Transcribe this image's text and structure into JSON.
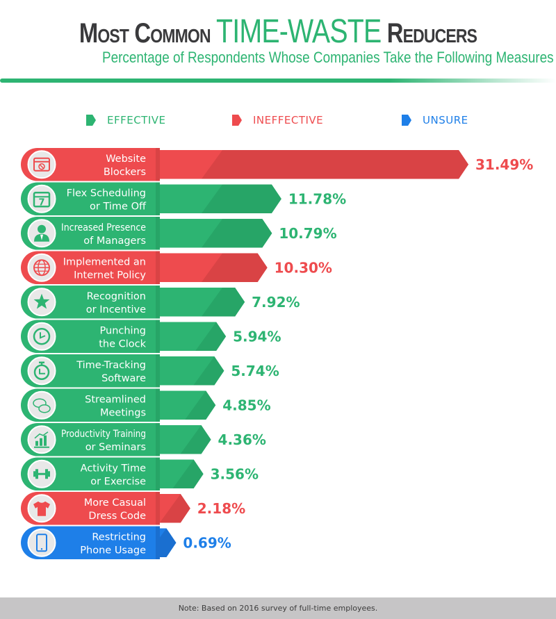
{
  "header": {
    "title_part1": "Most Common",
    "title_accent": "TIME-WASTE",
    "title_part2": "Reducers",
    "subtitle": "Percentage of Respondents Whose Companies Take the Following Measures"
  },
  "colors": {
    "effective": "#2db472",
    "effective_dark": "#27a567",
    "ineffective": "#ee4b4e",
    "ineffective_dark": "#d94345",
    "unsure": "#1e7fe8",
    "unsure_dark": "#1a6fd0",
    "title": "#3a3a3c"
  },
  "legend": [
    {
      "key": "effective",
      "label": "EFFECTIVE"
    },
    {
      "key": "ineffective",
      "label": "INEFFECTIVE"
    },
    {
      "key": "unsure",
      "label": "UNSURE"
    }
  ],
  "chart_data": {
    "type": "bar",
    "orientation": "horizontal",
    "title": "Most Common TIME-WASTE Reducers",
    "subtitle": "Percentage of Respondents Whose Companies Take the Following Measures",
    "unit": "%",
    "legend_position": "top",
    "categories": [
      "Website Blockers",
      "Flex Scheduling or Time Off",
      "Increased Presence of Managers",
      "Implemented an Internet Policy",
      "Recognition or Incentive",
      "Punching the Clock",
      "Time-Tracking Software",
      "Streamlined Meetings",
      "Productivity Training or Seminars",
      "Activity Time or Exercise",
      "More Casual Dress Code",
      "Restricting Phone Usage"
    ],
    "values": [
      31.49,
      11.78,
      10.79,
      10.3,
      7.92,
      5.94,
      5.74,
      4.85,
      4.36,
      3.56,
      2.18,
      0.69
    ],
    "value_labels": [
      "31.49%",
      "11.78%",
      "10.79%",
      "10.30%",
      "7.92%",
      "5.94%",
      "5.74%",
      "4.85%",
      "4.36%",
      "3.56%",
      "2.18%",
      "0.69%"
    ],
    "bars": [
      {
        "line1": "Website",
        "line2": "Blockers",
        "effectiveness": "ineffective",
        "icon": "website-blocker-icon"
      },
      {
        "line1": "Flex Scheduling",
        "line2": "or Time Off",
        "effectiveness": "effective",
        "icon": "calendar-icon"
      },
      {
        "line1": "Increased Presence",
        "line2": "of Managers",
        "effectiveness": "effective",
        "icon": "manager-icon"
      },
      {
        "line1": "Implemented an",
        "line2": "Internet Policy",
        "effectiveness": "ineffective",
        "icon": "globe-icon"
      },
      {
        "line1": "Recognition",
        "line2": "or Incentive",
        "effectiveness": "effective",
        "icon": "star-icon"
      },
      {
        "line1": "Punching",
        "line2": "the Clock",
        "effectiveness": "effective",
        "icon": "clock-icon"
      },
      {
        "line1": "Time-Tracking",
        "line2": "Software",
        "effectiveness": "effective",
        "icon": "stopwatch-icon"
      },
      {
        "line1": "Streamlined",
        "line2": "Meetings",
        "effectiveness": "effective",
        "icon": "chat-bubbles-icon"
      },
      {
        "line1": "Productivity Training",
        "line2": "or Seminars",
        "effectiveness": "effective",
        "icon": "growth-chart-icon"
      },
      {
        "line1": "Activity Time",
        "line2": "or Exercise",
        "effectiveness": "effective",
        "icon": "dumbbell-icon"
      },
      {
        "line1": "More Casual",
        "line2": "Dress Code",
        "effectiveness": "ineffective",
        "icon": "tshirt-icon"
      },
      {
        "line1": "Restricting",
        "line2": "Phone Usage",
        "effectiveness": "unsure",
        "icon": "phone-icon"
      }
    ],
    "xlim": [
      0,
      31.49
    ]
  },
  "footer": {
    "note": "Note: Based on 2016 survey of full-time employees."
  }
}
